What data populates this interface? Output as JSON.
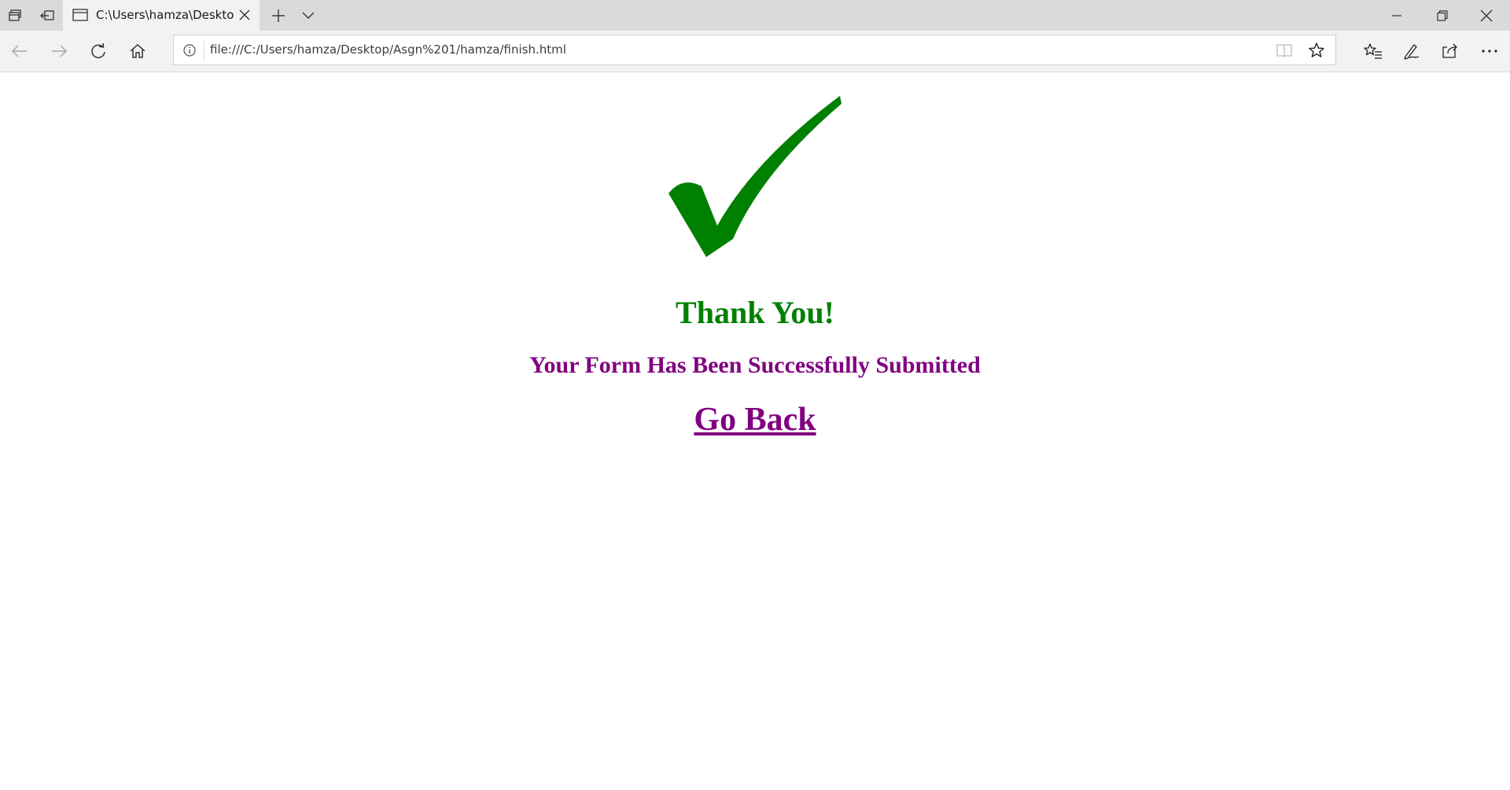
{
  "browser": {
    "tab": {
      "title": "C:\\Users\\hamza\\Deskto"
    },
    "address_bar": {
      "url": "file:///C:/Users/hamza/Desktop/Asgn%201/hamza/finish.html"
    },
    "icons": {
      "tab_manager": "tab-manager-icon",
      "set_aside_tabs": "set-aside-tabs-icon",
      "page": "page-icon",
      "close_tab": "close-icon",
      "new_tab": "plus-icon",
      "tab_preview": "chevron-down-icon",
      "minimize": "minimize-icon",
      "restore": "restore-icon",
      "close_window": "close-icon",
      "back": "arrow-left-icon",
      "forward": "arrow-right-icon",
      "refresh": "refresh-icon",
      "home": "home-icon",
      "site_info": "info-icon",
      "reading_view": "book-icon",
      "favorite": "star-icon",
      "favorites_hub": "favorites-list-icon",
      "web_note": "pen-icon",
      "share": "share-icon",
      "more": "more-icon"
    }
  },
  "page": {
    "checkmark_color": "#008000",
    "thanks_text": "Thank You!",
    "subtitle_text": "Your Form Has Been Successfully Submitted",
    "go_back_text": "Go Back",
    "colors": {
      "thanks": "#008000",
      "subtitle": "#800080",
      "link": "#800080"
    }
  }
}
